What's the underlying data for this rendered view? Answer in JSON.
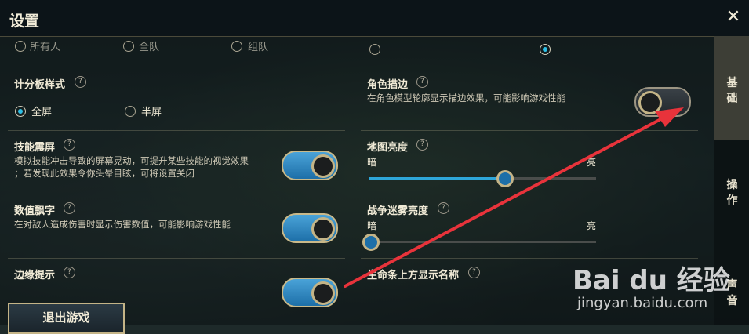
{
  "title": "设置",
  "close_label": "✕",
  "top_row": {
    "left_options": [
      "所有人",
      "全队",
      "组队"
    ]
  },
  "scoreboard": {
    "label": "计分板样式",
    "help": "?",
    "options": [
      "全屏",
      "半屏"
    ],
    "selected": "全屏"
  },
  "outline": {
    "label": "角色描边",
    "help": "?",
    "desc": "在角色模型轮廓显示描边效果，可能影响游戏性能",
    "enabled": false
  },
  "shake": {
    "label": "技能震屏",
    "help": "?",
    "desc_line1": "模拟技能冲击导致的屏幕晃动，可提升某些技能的视觉效果",
    "desc_line2": "；若发现此效果令你头晕目眩，可将设置关闭",
    "enabled": true
  },
  "map_brightness": {
    "label": "地图亮度",
    "help": "?",
    "min_label": "暗",
    "max_label": "亮",
    "value": 0.59
  },
  "damage_numbers": {
    "label": "数值飘字",
    "help": "?",
    "desc": "在对敌人造成伤害时显示伤害数值，可能影响游戏性能",
    "enabled": true
  },
  "fog_brightness": {
    "label": "战争迷雾亮度",
    "help": "?",
    "min_label": "暗",
    "max_label": "亮",
    "value": 0.0
  },
  "edge_hint": {
    "label": "边缘提示",
    "help": "?"
  },
  "health_bar_name": {
    "label": "生命条上方显示名称",
    "help": "?"
  },
  "tabs": [
    "基础",
    "操作",
    "声音"
  ],
  "active_tab": "基础",
  "exit_button": "退出游戏",
  "watermark": {
    "brand": "Bai du 经验",
    "url": "jingyan.baidu.com"
  },
  "colors": {
    "accent": "#2ea6d9",
    "gold_border": "#c4b487",
    "arrow": "#e8333b"
  }
}
